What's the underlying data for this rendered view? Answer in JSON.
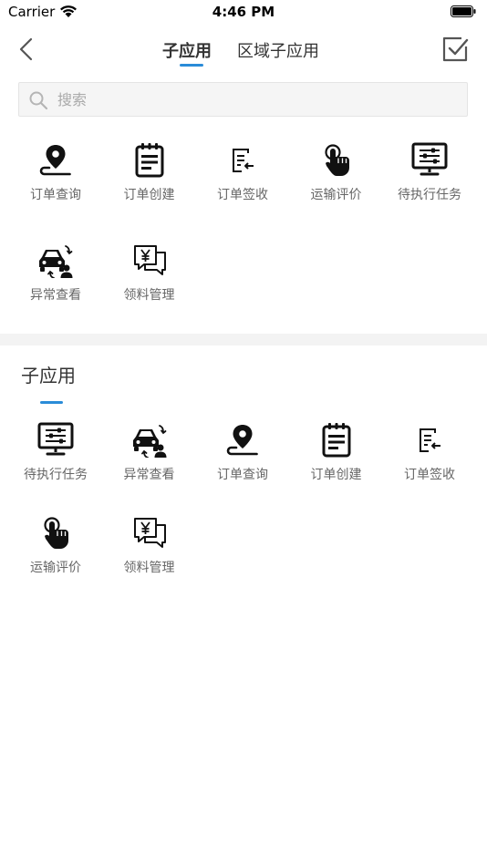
{
  "status_bar": {
    "carrier": "Carrier",
    "time": "4:46 PM"
  },
  "nav": {
    "tabs": [
      {
        "label": "子应用"
      },
      {
        "label": "区域子应用"
      }
    ]
  },
  "search": {
    "placeholder": "搜索"
  },
  "top_apps": [
    {
      "label": "订单查询",
      "icon": "location-pin-icon"
    },
    {
      "label": "订单创建",
      "icon": "notepad-icon"
    },
    {
      "label": "订单签收",
      "icon": "sign-document-icon"
    },
    {
      "label": "运输评价",
      "icon": "hand-pointer-icon"
    },
    {
      "label": "待执行任务",
      "icon": "monitor-settings-icon"
    },
    {
      "label": "异常查看",
      "icon": "car-person-icon"
    },
    {
      "label": "领料管理",
      "icon": "yen-chat-icon"
    }
  ],
  "section": {
    "title": "子应用",
    "apps": [
      {
        "label": "待执行任务",
        "icon": "monitor-settings-icon"
      },
      {
        "label": "异常查看",
        "icon": "car-person-icon"
      },
      {
        "label": "订单查询",
        "icon": "location-pin-icon"
      },
      {
        "label": "订单创建",
        "icon": "notepad-icon"
      },
      {
        "label": "订单签收",
        "icon": "sign-document-icon"
      },
      {
        "label": "运输评价",
        "icon": "hand-pointer-icon"
      },
      {
        "label": "领料管理",
        "icon": "yen-chat-icon"
      }
    ]
  },
  "colors": {
    "accent": "#2a8cd8",
    "divider": "#f3f3f3",
    "search_bg": "#f5f5f5"
  }
}
